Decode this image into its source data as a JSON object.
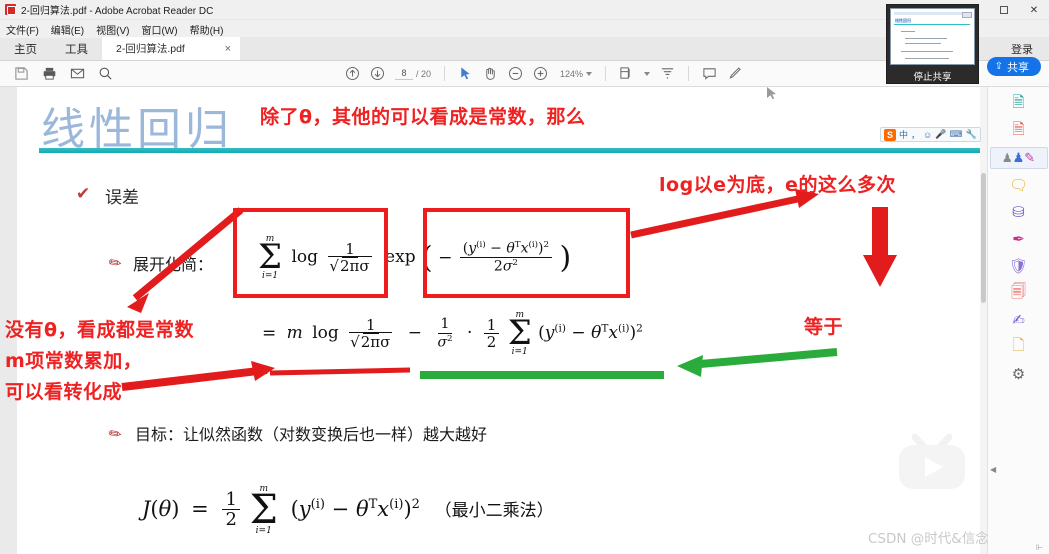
{
  "window": {
    "title": "2-回归算法.pdf - Adobe Acrobat Reader DC",
    "app_icon": "pdf-icon",
    "maximize_label": "□",
    "close_label": "✕"
  },
  "menubar": {
    "items": [
      {
        "label": "文件(F)",
        "name": "file"
      },
      {
        "label": "编辑(E)",
        "name": "edit"
      },
      {
        "label": "视图(V)",
        "name": "view"
      },
      {
        "label": "窗口(W)",
        "name": "window"
      },
      {
        "label": "帮助(H)",
        "name": "help"
      }
    ]
  },
  "tabs": {
    "home": "主页",
    "tools": "工具",
    "document": "2-回归算法.pdf",
    "close": "×",
    "signin": "登录"
  },
  "toolbar": {
    "save_icon": "save-icon",
    "print_icon": "print-icon",
    "email_icon": "email-icon",
    "search_icon": "search-icon",
    "prev_page_icon": "arrow-up-circle-icon",
    "next_page_icon": "arrow-down-circle-icon",
    "page_current": "8",
    "page_total": "/ 20",
    "select_icon": "cursor-arrow-icon",
    "hand_icon": "hand-icon",
    "zoom_out_icon": "minus-circle-icon",
    "zoom_in_icon": "plus-circle-icon",
    "zoom_level": "124%",
    "fit_icon": "fit-page-icon",
    "fullscreen_icon": "fit-width-icon",
    "comment_icon": "comment-icon",
    "highlight_icon": "highlight-pen-icon",
    "share_label": "共享",
    "share_icon": "share-icon",
    "share_color": "#1473e6"
  },
  "slide": {
    "title": "线性回归",
    "title_color": "#9bb7d9",
    "rule_color": "#2fc0c6",
    "bullet1": "误差",
    "bullet1_icon": "check-mark-icon",
    "line2_icon": "pencil-icon",
    "line2": "展开化简：",
    "line3_icon": "pencil-icon",
    "line3": "目标：让似然函数（对数变换后也一样）越大越好",
    "formula1": "Σ(i=1..m) log 1/√(2πσ) exp( − (y⁽ⁱ⁾ − θᵀx⁽ⁱ⁾)² / 2σ² )",
    "formula2": "= m log 1/√(2πσ) − 1/σ² · 1/2 Σ(i=1..m) (y⁽ⁱ⁾ − θᵀx⁽ⁱ⁾)²",
    "formula3_left": "J(θ) =",
    "formula3_note": "（最小二乘法）",
    "sum_upper": "m",
    "sum_lower": "i=1",
    "half_num": "1",
    "half_den": "2"
  },
  "annotations": {
    "color_red": "#ee2222",
    "color_green": "#2bab3b",
    "top_note": "除了θ，其他的可以看成是常数，那么",
    "right_note": "log以e为底，e的这么多次",
    "left_note_line1": "没有θ，看成都是常数",
    "left_note_line2": "m项常数累加，",
    "left_note_line3": "可以看转化成",
    "equal_note": "等于"
  },
  "rail": {
    "items": [
      {
        "name": "export-pdf-icon",
        "glyph": "⎙",
        "color": "#1ba39c"
      },
      {
        "name": "create-pdf-icon",
        "glyph": "🗎",
        "color": "#e2574c"
      },
      {
        "name": "edit-pdf-icon",
        "glyph": "✎",
        "color": "#c0399f"
      },
      {
        "name": "comment-icon",
        "glyph": "💬",
        "color": "#e8b530"
      },
      {
        "name": "combine-files-icon",
        "glyph": "⛁",
        "color": "#6a5acd"
      },
      {
        "name": "fill-sign-icon",
        "glyph": "✒",
        "color": "#cc2e8a"
      },
      {
        "name": "protect-icon",
        "glyph": "🛡",
        "color": "#8a6fd8"
      },
      {
        "name": "compress-pdf-icon",
        "glyph": "🗜",
        "color": "#e2574c"
      },
      {
        "name": "request-signature-icon",
        "glyph": "✍",
        "color": "#7a5ad8"
      },
      {
        "name": "more-tools-icon",
        "glyph": "🗋",
        "color": "#e0b030"
      },
      {
        "name": "settings-icon",
        "glyph": "⚙",
        "color": "#666666"
      }
    ],
    "selected_index": 2,
    "collapse_icon": "collapse-panel-icon"
  },
  "share_overlay": {
    "stop_label": "停止共享",
    "thumb_title": "线性回归",
    "name": "screen-share-control"
  },
  "ime": {
    "logo": "S",
    "mode": "中",
    "items": [
      "中",
      "，",
      "☺",
      "🎤",
      "⌨",
      "🔧"
    ]
  },
  "watermark": {
    "text": "CSDN @时代&信念",
    "logo": "bilibili-tv-icon"
  }
}
